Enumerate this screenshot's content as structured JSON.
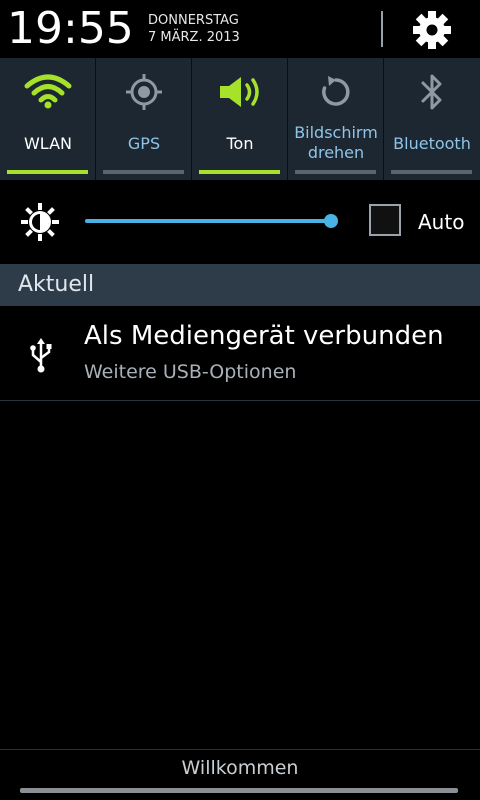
{
  "status": {
    "time": "19:55",
    "weekday": "DONNERSTAG",
    "date": "7 MÄRZ. 2013",
    "settings_icon": "gear-icon"
  },
  "toggles": [
    {
      "label": "WLAN",
      "icon": "wifi-icon",
      "state": "on"
    },
    {
      "label": "GPS",
      "icon": "gps-icon",
      "state": "off"
    },
    {
      "label": "Ton",
      "icon": "sound-icon",
      "state": "on"
    },
    {
      "label_line1": "Bildschirm",
      "label_line2": "drehen",
      "icon": "rotate-icon",
      "state": "off"
    },
    {
      "label": "Bluetooth",
      "icon": "bluetooth-icon",
      "state": "off"
    }
  ],
  "brightness": {
    "icon": "brightness-icon",
    "level": 1.0,
    "auto_label": "Auto",
    "auto_checked": false
  },
  "section": {
    "title": "Aktuell"
  },
  "notification": {
    "icon": "usb-icon",
    "title": "Als Mediengerät verbunden",
    "subtitle": "Weitere USB-Optionen"
  },
  "footer": {
    "carrier": "Willkommen"
  },
  "colors": {
    "accent_green": "#a6e22a",
    "accent_blue": "#4ab3e6",
    "label_blue": "#8fc4e8"
  }
}
